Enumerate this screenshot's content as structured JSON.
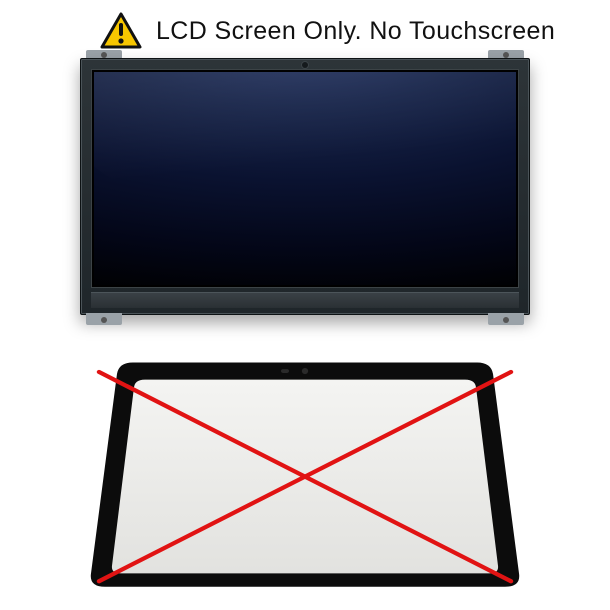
{
  "header": {
    "warning_icon": "warning-triangle-icon",
    "text": "LCD Screen Only. No Touchscreen"
  },
  "lcd": {
    "label": "lcd-screen-panel"
  },
  "touchscreen": {
    "label": "touchscreen-digitizer",
    "excluded": true
  },
  "colors": {
    "warning_yellow": "#F7C600",
    "warning_border": "#111111",
    "cross_red": "#E11313"
  }
}
